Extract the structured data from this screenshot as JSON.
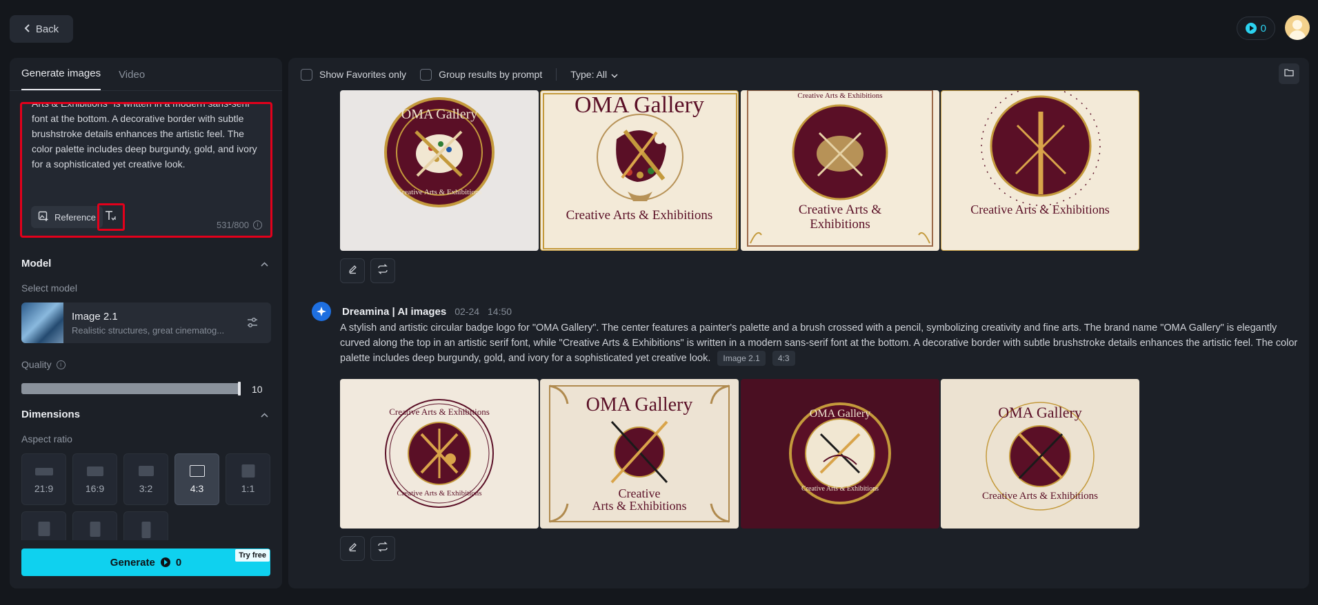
{
  "topbar": {
    "back_label": "Back",
    "credits": "0"
  },
  "left_panel": {
    "tabs": [
      {
        "label": "Generate images",
        "active": true
      },
      {
        "label": "Video",
        "active": false
      }
    ],
    "prompt": {
      "value_visible": "Arts & Exhibitions\" is written in a modern sans-serif font at the bottom. A decorative border with subtle brushstroke details enhances the artistic feel. The color palette includes deep burgundy, gold, and ivory for a sophisticated yet creative look.",
      "reference_label": "Reference",
      "char_count": "531/800"
    },
    "model": {
      "section_title": "Model",
      "select_label": "Select model",
      "name": "Image 2.1",
      "description": "Realistic structures, great cinematog..."
    },
    "quality": {
      "label": "Quality",
      "value": "10",
      "fill_fraction": 1.0
    },
    "dimensions": {
      "section_title": "Dimensions",
      "aspect_label": "Aspect ratio",
      "ratios": [
        {
          "label": "21:9",
          "active": false
        },
        {
          "label": "16:9",
          "active": false
        },
        {
          "label": "3:2",
          "active": false
        },
        {
          "label": "4:3",
          "active": true
        },
        {
          "label": "1:1",
          "active": false
        }
      ]
    },
    "generate": {
      "label": "Generate",
      "cost": "0",
      "badge": "Try free"
    }
  },
  "right_panel": {
    "filters": {
      "favorites_label": "Show Favorites only",
      "group_label": "Group results by prompt",
      "type_label": "Type: All"
    },
    "first_batch": {
      "captions": [
        "OMA Gallery",
        "Creative Arts & Exhibitions",
        "OMA Gallery",
        "Creative Arts & Exhibitions",
        "Creative Arts & Exhibitions",
        "Creative Arts &",
        "Exhibitions",
        "Creative Arts & Exhibitions"
      ]
    },
    "second_batch": {
      "author": "Dreamina | AI images",
      "date": "02-24",
      "time": "14:50",
      "prompt": "A stylish and artistic circular badge logo for \"OMA Gallery\". The center features a painter's palette and a brush crossed with a pencil, symbolizing creativity and fine arts. The brand name \"OMA Gallery\" is elegantly curved along the top in an artistic serif font, while \"Creative Arts & Exhibitions\" is written in a modern sans-serif font at the bottom. A decorative border with subtle brushstroke details enhances the artistic feel. The color palette includes deep burgundy, gold, and ivory for a sophisticated yet creative look.",
      "model_chip": "Image 2.1",
      "ratio_chip": "4:3",
      "captions": [
        "Creative Arts & Exhibitions",
        "Creative Arts & Exhibitions",
        "OMA Gallery",
        "Creative",
        "Arts & Exhibitions",
        "OMA Gallery",
        "Creative Arts & Exhibitions",
        "OMA Gallery",
        "Creative Arts & Exhibitions"
      ]
    }
  },
  "colors": {
    "accent": "#0fd1ef",
    "burgundy": "#5a0f26",
    "gold": "#c49a3c",
    "ivory": "#f1e7d2",
    "highlight": "#e3001b"
  }
}
